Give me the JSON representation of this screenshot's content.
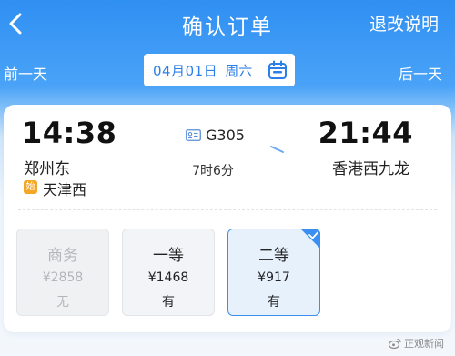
{
  "header": {
    "title": "确认订单",
    "right_link": "退改说明"
  },
  "datebar": {
    "prev_label": "前一天",
    "next_label": "后一天",
    "date": "04月01日",
    "weekday": "周六"
  },
  "trip": {
    "departure_time": "14:38",
    "departure_station": "郑州东",
    "origin_badge": "始",
    "origin_station": "天津西",
    "train_no": "G305",
    "duration": "7时6分",
    "arrival_time": "21:44",
    "arrival_station": "香港西九龙"
  },
  "seats": [
    {
      "name": "商务",
      "price": "¥2858",
      "availability": "无",
      "state": "disabled"
    },
    {
      "name": "一等",
      "price": "¥1468",
      "availability": "有",
      "state": "normal"
    },
    {
      "name": "二等",
      "price": "¥917",
      "availability": "有",
      "state": "selected"
    }
  ],
  "watermark": {
    "text": "正观新闻",
    "icon": "weibo-icon"
  },
  "colors": {
    "header_blue": "#2f8ff2",
    "accent_blue": "#3a8ff0",
    "origin_badge": "#f5a623"
  }
}
